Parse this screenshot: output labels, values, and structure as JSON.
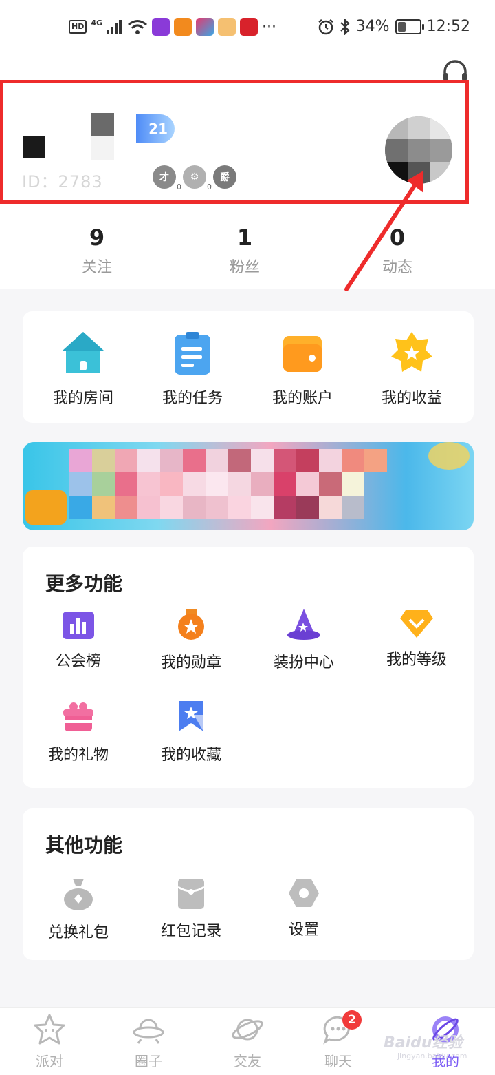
{
  "status_bar": {
    "battery": "34%",
    "time": "12:52",
    "hd": "HD",
    "network": "4G",
    "more": "···"
  },
  "profile": {
    "id_text": "ID：2783",
    "level": "21",
    "medals": [
      {
        "glyph": "才",
        "count": "0"
      },
      {
        "glyph": "⚙",
        "count": "0"
      },
      {
        "glyph": "爵",
        "count": ""
      }
    ]
  },
  "stats": [
    {
      "value": "9",
      "label": "关注"
    },
    {
      "value": "1",
      "label": "粉丝"
    },
    {
      "value": "0",
      "label": "动态"
    }
  ],
  "quick_actions": [
    {
      "label": "我的房间",
      "icon": "house-icon"
    },
    {
      "label": "我的任务",
      "icon": "clipboard-icon"
    },
    {
      "label": "我的账户",
      "icon": "wallet-icon"
    },
    {
      "label": "我的收益",
      "icon": "star-badge-icon"
    }
  ],
  "more_functions": {
    "title": "更多功能",
    "items": [
      {
        "label": "公会榜",
        "icon": "bar-chart-icon"
      },
      {
        "label": "我的勋章",
        "icon": "medal-icon"
      },
      {
        "label": "装扮中心",
        "icon": "wizard-hat-icon"
      },
      {
        "label": "我的等级",
        "icon": "diamond-icon"
      },
      {
        "label": "我的礼物",
        "icon": "gift-icon"
      },
      {
        "label": "我的收藏",
        "icon": "bookmark-icon"
      }
    ]
  },
  "other_functions": {
    "title": "其他功能",
    "items": [
      {
        "label": "兑换礼包",
        "icon": "money-bag-icon"
      },
      {
        "label": "红包记录",
        "icon": "red-envelope-icon"
      },
      {
        "label": "设置",
        "icon": "settings-icon"
      }
    ]
  },
  "tabbar": [
    {
      "label": "派对",
      "icon": "star-face-icon",
      "badge": ""
    },
    {
      "label": "圈子",
      "icon": "ufo-icon",
      "badge": ""
    },
    {
      "label": "交友",
      "icon": "planet-icon",
      "badge": ""
    },
    {
      "label": "聊天",
      "icon": "chat-icon",
      "badge": "2"
    },
    {
      "label": "我的",
      "icon": "profile-planet-icon",
      "badge": ""
    }
  ],
  "watermark": {
    "brand": "Baidu经验",
    "url": "jingyan.baidu.com"
  },
  "colors": {
    "highlight": "#ee2b2b",
    "accent": "#7b5cf5",
    "badge": "#f13b3b"
  }
}
